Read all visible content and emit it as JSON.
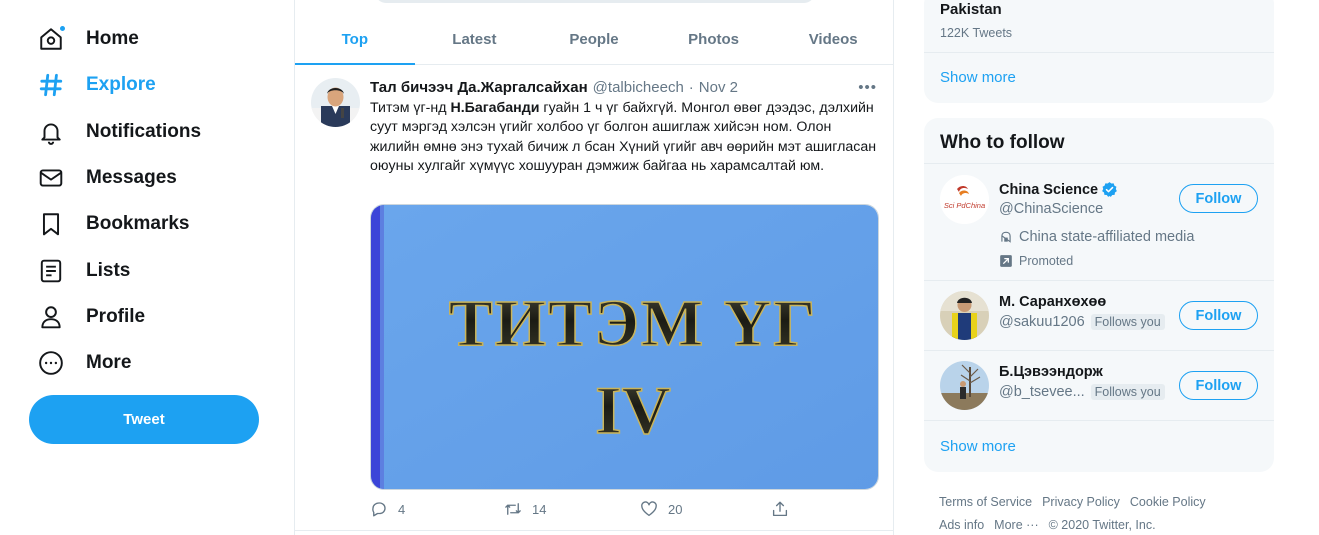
{
  "nav": {
    "items": [
      {
        "label": "Home"
      },
      {
        "label": "Explore"
      },
      {
        "label": "Notifications"
      },
      {
        "label": "Messages"
      },
      {
        "label": "Bookmarks"
      },
      {
        "label": "Lists"
      },
      {
        "label": "Profile"
      },
      {
        "label": "More"
      }
    ],
    "active": "Explore",
    "tweet_button": "Tweet"
  },
  "search": {
    "tabs": [
      "Top",
      "Latest",
      "People",
      "Photos",
      "Videos"
    ],
    "active_tab": "Top"
  },
  "tweet": {
    "author_name": "Тал бичээч Да.Жаргалсайхан",
    "author_handle": "@talbicheech",
    "separator": "·",
    "date": "Nov 2",
    "more_icon": "•••",
    "text_part1": "Титэм үг-нд ",
    "text_bold": "Н.Багабанди",
    "text_part2": " гуайн 1 ч үг байхгүй. Монгол өвөг дээдэс, дэлхийн суут мэргэд хэлсэн үгийг холбоо үг болгон ашиглаж хийсэн ном. Олон жилийн өмнө энэ тухай бичиж л бсан Хүний үгийг авч өөрийн мэт ашигласан оюуны хулгайг хүмүүс хошууран дэмжиж байгаа нь харамсалтай юм.",
    "image_title_line1": "ТИТЭМ ҮГ",
    "image_title_line2": "IV",
    "replies": "4",
    "retweets": "14",
    "likes": "20"
  },
  "trend": {
    "title": "Pakistan",
    "count": "122K Tweets",
    "show_more": "Show more"
  },
  "who_to_follow": {
    "title": "Who to follow",
    "accounts": [
      {
        "name": "China Science",
        "handle": "@ChinaScience",
        "verified": true,
        "affiliation": "China state-affiliated media",
        "promoted": "Promoted",
        "follow": "Follow",
        "avatar_text": "Sci PdChina"
      },
      {
        "name": "М. Саранхөхөө",
        "handle": "@sakuu1206",
        "follows_you": "Follows you",
        "follow": "Follow"
      },
      {
        "name": "Б.Цэвээндорж",
        "handle": "@b_tsevee...",
        "follows_you": "Follows you",
        "follow": "Follow"
      }
    ],
    "show_more": "Show more"
  },
  "footer": {
    "links": [
      "Terms of Service",
      "Privacy Policy",
      "Cookie Policy",
      "Ads info",
      "More ···"
    ],
    "copyright": "© 2020 Twitter, Inc."
  },
  "colors": {
    "accent": "#1da1f2",
    "text": "#14171a",
    "secondary": "#657786",
    "panel": "#f5f8fa",
    "border": "#e6ecf0"
  }
}
